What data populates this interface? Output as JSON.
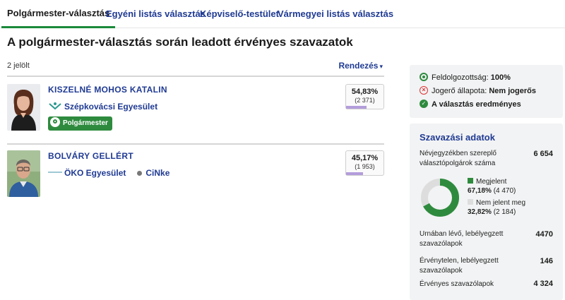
{
  "tabs": [
    {
      "label": "Polgármester-választás",
      "active": true
    },
    {
      "label": "Egyéni listás választás",
      "active": false
    },
    {
      "label": "Képviselő-testület",
      "active": false
    },
    {
      "label": "Vármegyei listás választás",
      "active": false
    }
  ],
  "page_title": "A polgármester-választás során leadott érvényes szavazatok",
  "candidate_count": "2 jelölt",
  "sort_label": "Rendezés",
  "candidates": [
    {
      "name": "KISZELNÉ MOHOS KATALIN",
      "party": "Szépkovácsi Egyesület",
      "badge": "Polgármester",
      "percent": "54,83%",
      "votes": "(2 371)",
      "share": 0.5483
    },
    {
      "name": "BOLVÁRY GELLÉRT",
      "party": "ÖKO Egyesület",
      "party2": "CiNke",
      "percent": "45,17%",
      "votes": "(1 953)",
      "share": 0.4517
    }
  ],
  "status": {
    "processed_label": "Feldolgozottság:",
    "processed_value": "100%",
    "legal_label": "Jogerő állapota:",
    "legal_value": "Nem jogerős",
    "result_text": "A választás eredményes"
  },
  "vote_data": {
    "title": "Szavazási adatok",
    "registered_label": "Névjegyzékben szereplő választópolgárok száma",
    "registered_value": "6 654",
    "turnout_label": "Megjelent",
    "turnout_pct": "67,18%",
    "turnout_count": "(4 470)",
    "turnout_share": 0.6718,
    "absent_label": "Nem jelent meg",
    "absent_pct": "32,82%",
    "absent_count": "(2 184)",
    "ballots_label": "Urnában lévő, lebélyegzett szavazólapok",
    "ballots_value": "4470",
    "invalid_label": "Érvénytelen, lebélyegzett szavazólapok",
    "invalid_value": "146",
    "valid_label": "Érvényes szavazólapok",
    "valid_value": "4 324"
  },
  "colors": {
    "accent_green": "#2e8b3e",
    "link_blue": "#1f3a93",
    "bar_purple": "#b39ddb",
    "absent_gray": "#dddddd"
  }
}
